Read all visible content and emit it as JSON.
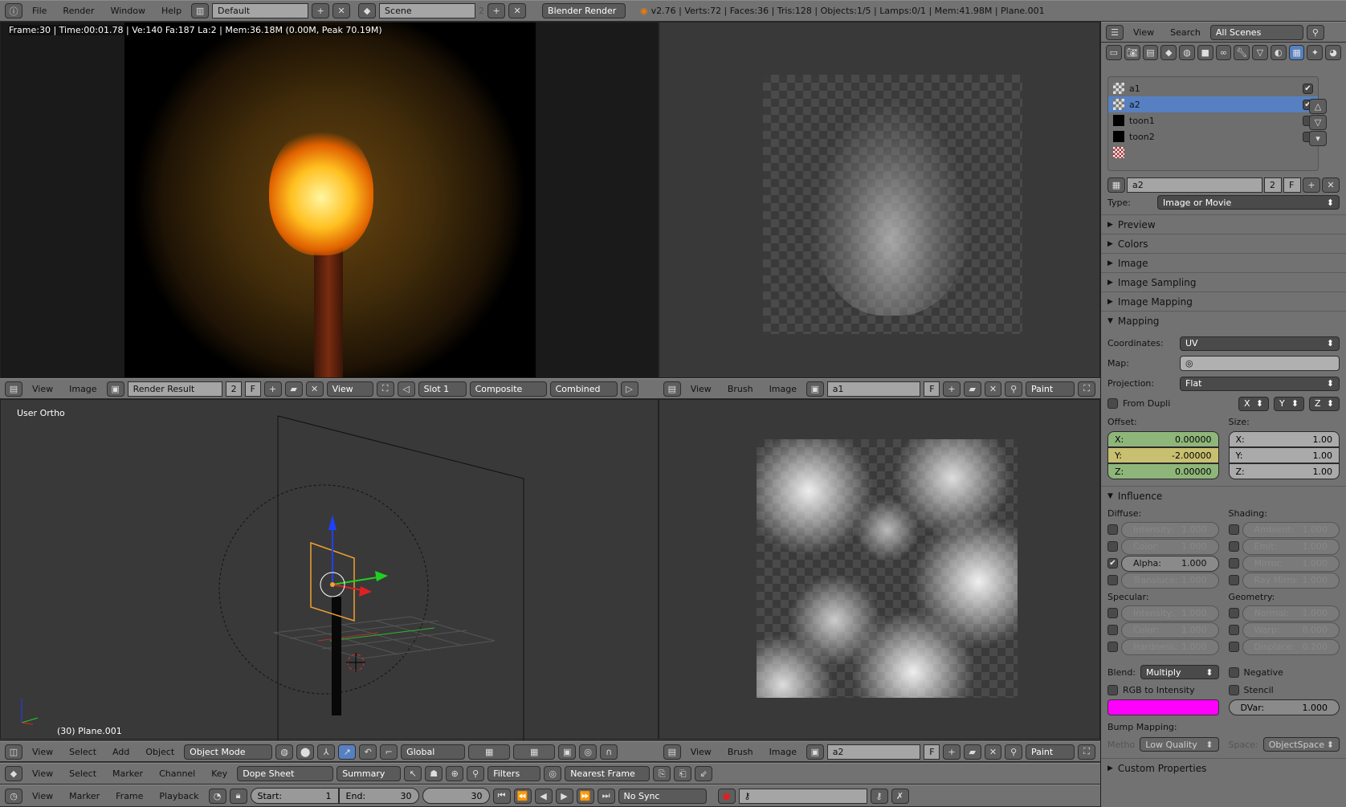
{
  "topbar": {
    "menus": [
      "File",
      "Render",
      "Window",
      "Help"
    ],
    "layout": "Default",
    "scene": "Scene",
    "scene_users": "2",
    "engine": "Blender Render",
    "stats": "v2.76 | Verts:72 | Faces:36 | Tris:128 | Objects:1/5 | Lamps:0/1 | Mem:41.98M | Plane.001"
  },
  "render_view": {
    "info": "Frame:30 | Time:00:01.78 | Ve:140 Fa:187 La:2 | Mem:36.18M (0.00M, Peak 70.19M)",
    "header": {
      "menus": [
        "View",
        "Image"
      ],
      "image": "Render Result",
      "users": "2",
      "fake": "F",
      "view": "View",
      "slot": "Slot 1",
      "layer": "Composite",
      "pass": "Combined"
    }
  },
  "image_top": {
    "header": {
      "menus": [
        "View",
        "Brush",
        "Image"
      ],
      "image": "a1",
      "fake": "F",
      "mode": "Paint"
    }
  },
  "image_bottom": {
    "header": {
      "menus": [
        "View",
        "Brush",
        "Image"
      ],
      "image": "a2",
      "fake": "F",
      "mode": "Paint"
    }
  },
  "viewport3d": {
    "view_label": "User Ortho",
    "object_label": "(30) Plane.001",
    "header": {
      "menus": [
        "View",
        "Select",
        "Add",
        "Object"
      ],
      "mode": "Object Mode",
      "orientation": "Global"
    }
  },
  "dopesheet": {
    "menus": [
      "View",
      "Select",
      "Marker",
      "Channel",
      "Key"
    ],
    "mode": "Dope Sheet",
    "summary": "Summary",
    "filters": "Filters",
    "snap": "Nearest Frame"
  },
  "timeline": {
    "menus": [
      "View",
      "Marker",
      "Frame",
      "Playback"
    ],
    "start_label": "Start:",
    "start": "1",
    "end_label": "End:",
    "end": "30",
    "current": "30",
    "sync": "No Sync"
  },
  "outliner": {
    "menus": [
      "View",
      "Search"
    ],
    "filter": "All Scenes"
  },
  "properties": {
    "texture_slots": [
      {
        "name": "a1",
        "enabled": true
      },
      {
        "name": "a2",
        "enabled": true,
        "selected": true
      },
      {
        "name": "toon1",
        "enabled": false
      },
      {
        "name": "toon2",
        "enabled": false
      }
    ],
    "texture_name": "a2",
    "texture_users": "2",
    "fake": "F",
    "type_label": "Type:",
    "type": "Image or Movie",
    "collapsed_panels": [
      "Preview",
      "Colors",
      "Image",
      "Image Sampling",
      "Image Mapping"
    ],
    "mapping": {
      "title": "Mapping",
      "coordinates_label": "Coordinates:",
      "coordinates": "UV",
      "map_label": "Map:",
      "projection_label": "Projection:",
      "projection": "Flat",
      "from_dupli": "From Dupli",
      "axes": [
        "X",
        "Y",
        "Z"
      ],
      "offset_label": "Offset:",
      "size_label": "Size:",
      "offset": [
        {
          "k": "X:",
          "v": "0.00000"
        },
        {
          "k": "Y:",
          "v": "-2.00000"
        },
        {
          "k": "Z:",
          "v": "0.00000"
        }
      ],
      "size": [
        {
          "k": "X:",
          "v": "1.00"
        },
        {
          "k": "Y:",
          "v": "1.00"
        },
        {
          "k": "Z:",
          "v": "1.00"
        }
      ]
    },
    "influence": {
      "title": "Influence",
      "diffuse_label": "Diffuse:",
      "diffuse": [
        {
          "k": "Intensity:",
          "v": "1.000",
          "on": false
        },
        {
          "k": "Color:",
          "v": "1.000",
          "on": false
        },
        {
          "k": "Alpha:",
          "v": "1.000",
          "on": true
        },
        {
          "k": "Transluce:",
          "v": "1.000",
          "on": false
        }
      ],
      "shading_label": "Shading:",
      "shading": [
        {
          "k": "Ambient:",
          "v": "1.000"
        },
        {
          "k": "Emit:",
          "v": "1.000"
        },
        {
          "k": "Mirror:",
          "v": "1.000"
        },
        {
          "k": "Ray Mirro:",
          "v": "1.000"
        }
      ],
      "specular_label": "Specular:",
      "specular": [
        {
          "k": "Intensity:",
          "v": "1.000"
        },
        {
          "k": "Color:",
          "v": "1.000"
        },
        {
          "k": "Hardness:",
          "v": "1.000"
        }
      ],
      "geometry_label": "Geometry:",
      "geometry": [
        {
          "k": "Normal:",
          "v": "1.000"
        },
        {
          "k": "Warp:",
          "v": "0.000"
        },
        {
          "k": "Displace:",
          "v": "0.200"
        }
      ],
      "blend_label": "Blend:",
      "blend": "Multiply",
      "negative": "Negative",
      "rgb_to_intensity": "RGB to Intensity",
      "stencil": "Stencil",
      "color": "#ff00ff",
      "dvar_label": "DVar:",
      "dvar": "1.000",
      "bump_label": "Bump Mapping:",
      "method_label": "Metho",
      "method": "Low Quality",
      "space_label": "Space:",
      "space": "ObjectSpace"
    },
    "custom_properties": "Custom Properties"
  }
}
